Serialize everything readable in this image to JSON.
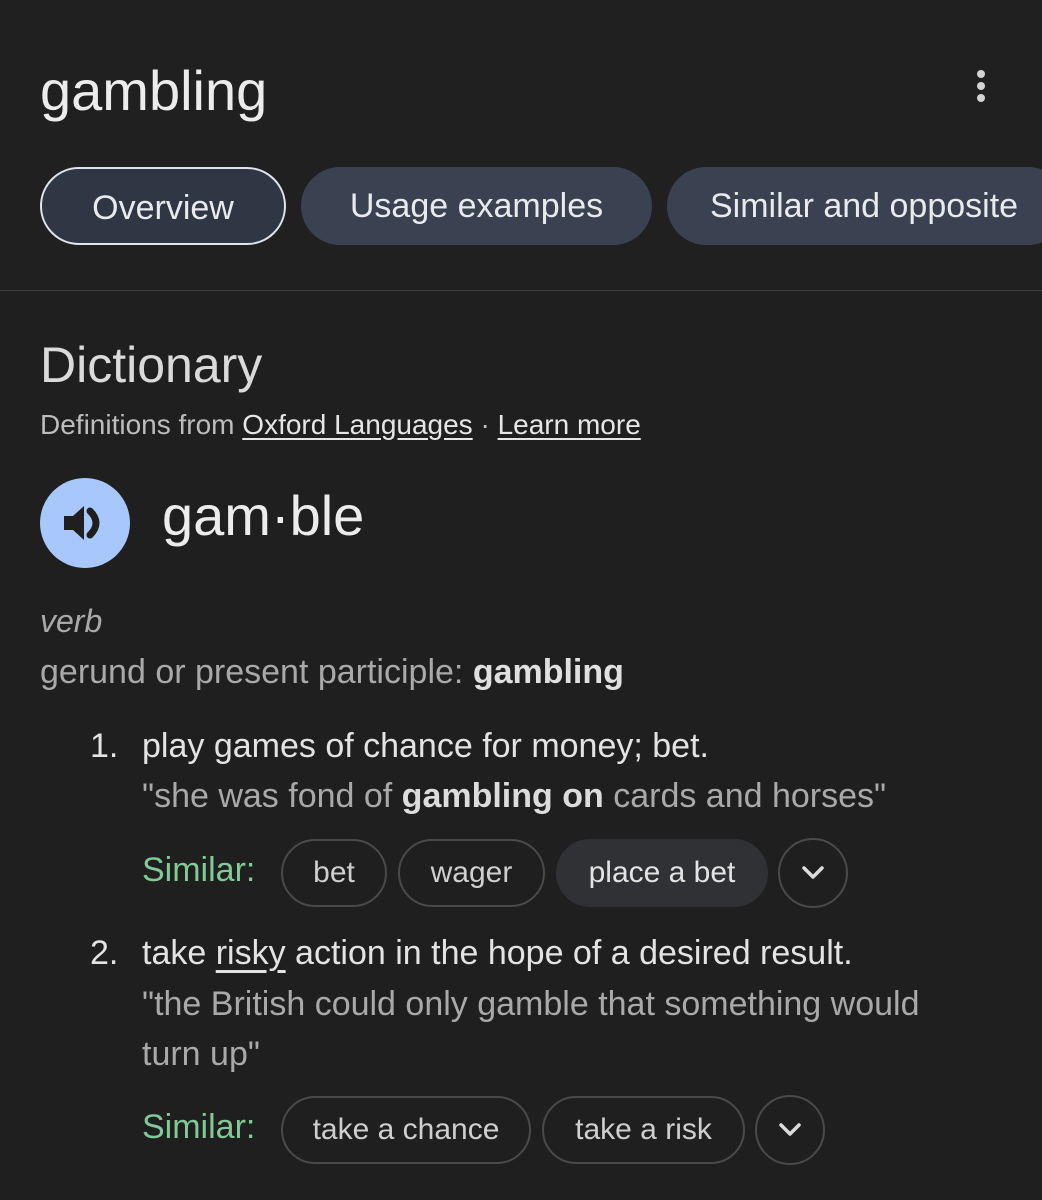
{
  "header": {
    "query": "gambling",
    "menu_icon": "more-vert-icon"
  },
  "tabs": [
    {
      "label": "Overview",
      "active": true
    },
    {
      "label": "Usage examples",
      "active": false
    },
    {
      "label": "Similar and opposite",
      "active": false
    }
  ],
  "dictionary": {
    "title": "Dictionary",
    "source_prefix": "Definitions from ",
    "source_name": "Oxford Languages",
    "separator": " · ",
    "learn_more": "Learn more",
    "speaker_icon": "volume-up-icon",
    "headword": "gam·ble",
    "part_of_speech": "verb",
    "inflection_label": "gerund or present participle: ",
    "inflection_value": "gambling",
    "senses": [
      {
        "number": "1.",
        "definition": "play games of chance for money; bet.",
        "example_pre": "\"she was fond of ",
        "example_bold": "gambling on",
        "example_post": " cards and horses\"",
        "similar_label": "Similar:",
        "similar": [
          "bet",
          "wager",
          "place a bet"
        ]
      },
      {
        "number": "2.",
        "definition_pre": "take ",
        "definition_link": "risky",
        "definition_post": " action in the hope of a desired result.",
        "example": "\"the British could only gamble that something would turn up\"",
        "similar_label": "Similar:",
        "similar": [
          "take a chance",
          "take a risk"
        ]
      }
    ],
    "expand_icon": "chevron-down-icon"
  },
  "colors": {
    "background": "#1f1f1f",
    "tab_bg": "#3a4150",
    "speaker_bg": "#a8c7fa",
    "similar_label": "#81c995"
  }
}
